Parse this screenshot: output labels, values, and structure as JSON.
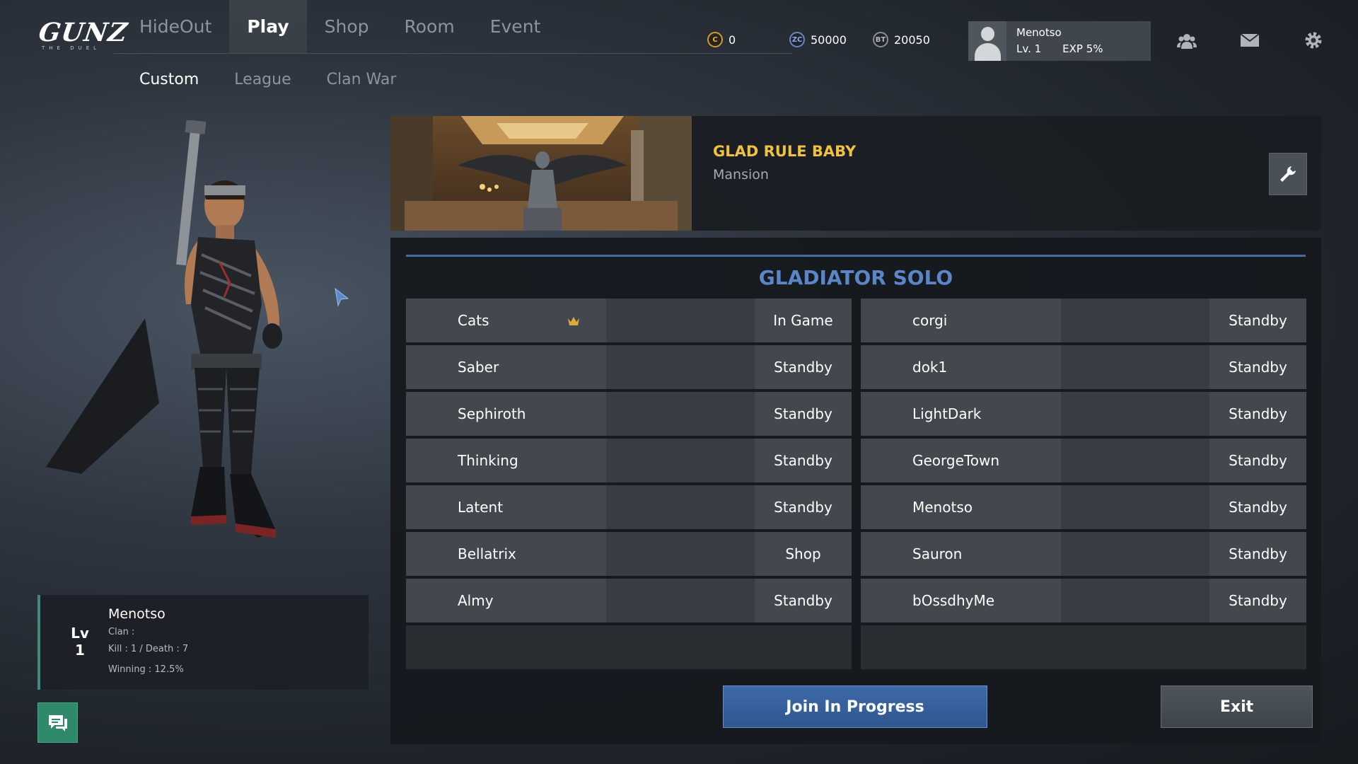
{
  "logo": {
    "text": "GUNZ",
    "subtext": "THE DUEL"
  },
  "nav": {
    "tabs": [
      {
        "label": "HideOut",
        "active": false
      },
      {
        "label": "Play",
        "active": true
      },
      {
        "label": "Shop",
        "active": false
      },
      {
        "label": "Room",
        "active": false
      },
      {
        "label": "Event",
        "active": false
      }
    ],
    "subtabs": [
      {
        "label": "Custom",
        "active": true
      },
      {
        "label": "League",
        "active": false
      },
      {
        "label": "Clan War",
        "active": false
      }
    ]
  },
  "currency": {
    "c": {
      "icon_text": "C",
      "value": "0"
    },
    "zc": {
      "icon_text": "ZC",
      "value": "50000"
    },
    "bt": {
      "icon_text": "BT",
      "value": "20050"
    }
  },
  "profile": {
    "name": "Menotso",
    "level": "Lv. 1",
    "exp": "EXP  5%"
  },
  "top_icons": [
    "friends-icon",
    "mail-icon",
    "settings-gear-icon"
  ],
  "character_stats": {
    "lv_label": "Lv",
    "lv_value": "1",
    "name": "Menotso",
    "clan": "Clan :",
    "kd": "Kill : 1 / Death : 7",
    "winning": "Winning : 12.5%"
  },
  "room": {
    "title": "GLAD RULE BABY",
    "map": "Mansion",
    "mode": "GLADIATOR SOLO"
  },
  "players_left": [
    {
      "name": "Cats",
      "status": "In Game",
      "host": true
    },
    {
      "name": "Saber",
      "status": "Standby",
      "host": false
    },
    {
      "name": "Sephiroth",
      "status": "Standby",
      "host": false
    },
    {
      "name": "Thinking",
      "status": "Standby",
      "host": false
    },
    {
      "name": "Latent",
      "status": "Standby",
      "host": false
    },
    {
      "name": "Bellatrix",
      "status": "Shop",
      "host": false
    },
    {
      "name": "Almy",
      "status": "Standby",
      "host": false
    }
  ],
  "players_right": [
    {
      "name": "corgi",
      "status": "Standby",
      "host": false
    },
    {
      "name": "dok1",
      "status": "Standby",
      "host": false
    },
    {
      "name": "LightDark",
      "status": "Standby",
      "host": false
    },
    {
      "name": "GeorgeTown",
      "status": "Standby",
      "host": false
    },
    {
      "name": "Menotso",
      "status": "Standby",
      "host": false
    },
    {
      "name": "Sauron",
      "status": "Standby",
      "host": false
    },
    {
      "name": "bOssdhyMe",
      "status": "Standby",
      "host": false
    }
  ],
  "buttons": {
    "join": "Join In Progress",
    "exit": "Exit"
  },
  "colors": {
    "room_title": "#f0c040",
    "mode_title": "#5a86c8",
    "accent_blue": "#3d6aa8",
    "chat_green": "#2e8a6a"
  }
}
